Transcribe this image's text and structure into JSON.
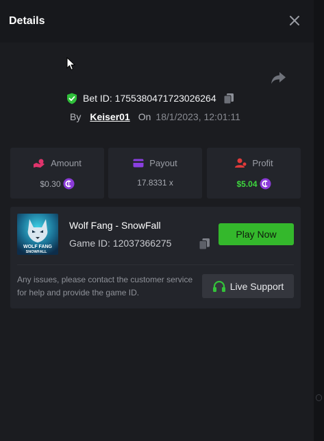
{
  "header": {
    "title": "Details",
    "close_icon": "close-icon"
  },
  "share": {
    "icon": "share-arrow-icon"
  },
  "bet": {
    "id_text": "Bet ID: 1755380471723026264",
    "by_label": "By",
    "username": "Keiser01",
    "on_label": "On",
    "datetime": "18/1/2023, 12:01:11"
  },
  "stats": {
    "amount": {
      "label": "Amount",
      "value": "$0.30",
      "icon": "wallet-hand-icon"
    },
    "payout": {
      "label": "Payout",
      "value": "17.8331 x",
      "icon": "card-icon"
    },
    "profit": {
      "label": "Profit",
      "value": "$5.04",
      "icon": "person-coins-icon"
    }
  },
  "game": {
    "name": "Wolf Fang - SnowFall",
    "id_text": "Game ID: 12037366275",
    "thumb_line1": "WOLF FANG",
    "thumb_line2": "SNOWFALL",
    "play_label": "Play Now"
  },
  "support": {
    "text": "Any issues, please contact the customer service for help and provide the game ID.",
    "button_label": "Live Support",
    "icon": "headset-icon"
  },
  "colors": {
    "accent_green": "#34b82c",
    "profit_green": "#3ed63e",
    "coin_purple": "#8b3bd8",
    "amount_pink": "#e0346c"
  }
}
